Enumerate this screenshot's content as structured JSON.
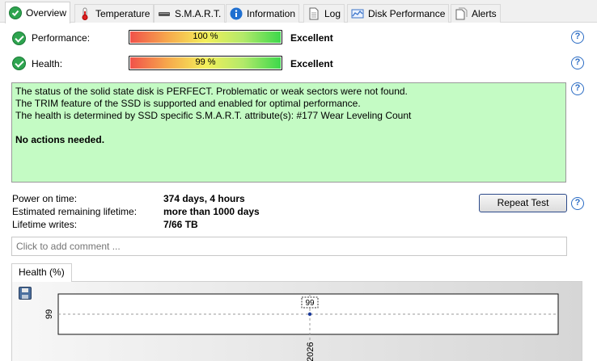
{
  "tabs": [
    {
      "label": "Overview",
      "icon": "check-icon",
      "active": true
    },
    {
      "label": "Temperature",
      "icon": "thermometer-icon"
    },
    {
      "label": "S.M.A.R.T.",
      "icon": "drive-icon"
    },
    {
      "label": "Information",
      "icon": "info-icon"
    },
    {
      "label": "Log",
      "icon": "log-document-icon"
    },
    {
      "label": "Disk Performance",
      "icon": "performance-chart-icon"
    },
    {
      "label": "Alerts",
      "icon": "alerts-document-icon"
    }
  ],
  "performance": {
    "label": "Performance:",
    "value": "100 %",
    "percent": 100,
    "rating": "Excellent"
  },
  "health": {
    "label": "Health:",
    "value": "99 %",
    "percent": 99,
    "rating": "Excellent"
  },
  "status": {
    "line1": "The status of the solid state disk is PERFECT. Problematic or weak sectors were not found.",
    "line2": "The TRIM feature of the SSD is supported and enabled for optimal performance.",
    "line3": "The health is determined by SSD specific S.M.A.R.T. attribute(s):  #177 Wear Leveling Count",
    "action": "No actions needed.",
    "background_color": "#c4fbc4"
  },
  "info": {
    "power_on_label": "Power on time:",
    "power_on_value": "374 days, 4 hours",
    "lifetime_label": "Estimated remaining lifetime:",
    "lifetime_value": "more than 1000 days",
    "writes_label": "Lifetime writes:",
    "writes_value": "7/66 TB"
  },
  "repeat_test_label": "Repeat Test",
  "comment_placeholder": "Click to add comment ...",
  "chart_tab_label": "Health (%)",
  "chart_data": {
    "type": "line",
    "title": "",
    "xlabel": "",
    "ylabel": "",
    "y_tick_labels": [
      "99"
    ],
    "x_tick_labels": [
      "2026"
    ],
    "series": [
      {
        "values": [
          99
        ]
      }
    ],
    "point_labels": [
      "99"
    ],
    "grid": true
  }
}
